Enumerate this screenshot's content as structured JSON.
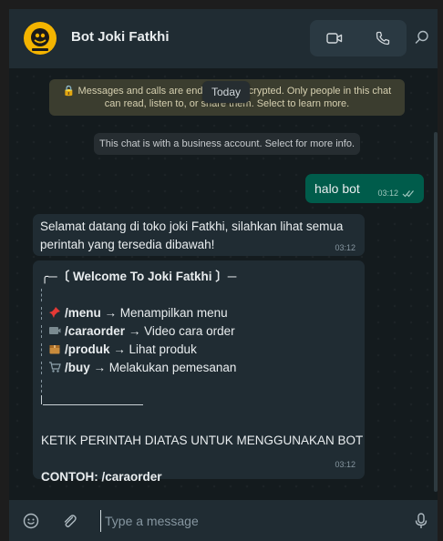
{
  "header": {
    "title": "Bot Joki Fatkhi",
    "icons": {
      "video": "video-camera-icon",
      "call": "phone-icon",
      "search": "search-icon"
    }
  },
  "chat": {
    "encryption_notice": "🔒 Messages and calls are end-to-end encrypted. Only people in this chat can read, listen to, or share them. Select to learn more.",
    "today_label": "Today",
    "business_notice": "This chat is with a business account. Select for more info.",
    "messages": [
      {
        "direction": "out",
        "text": "halo bot",
        "time": "03:12",
        "status": "read"
      },
      {
        "direction": "in",
        "text": "Selamat datang di toko joki Fatkhi, silahkan lihat semua perintah yang tersedia dibawah!",
        "time": "03:12"
      },
      {
        "direction": "in",
        "time": "03:12",
        "header": "╭─〔 Welcome To Joki Fatkhi 〕─",
        "commands": [
          {
            "cmd": "/menu",
            "desc": "→ Menampilkan menu"
          },
          {
            "cmd": "/caraorder",
            "desc": "→ Video cara order"
          },
          {
            "cmd": "/produk",
            "desc": "→ Lihat produk"
          },
          {
            "cmd": "/buy",
            "desc": "→ Melakukan pemesanan"
          }
        ],
        "instruction": "KETIK PERINTAH DIATAS UNTUK MENGGUNAKAN BOT",
        "example": "CONTOH: /caraorder"
      }
    ]
  },
  "footer": {
    "placeholder": "Type a message"
  },
  "colors": {
    "header_bg": "#202c33",
    "chat_bg": "#141b1e",
    "outgoing_bubble": "#005c4b",
    "incoming_bubble": "#202c33",
    "encryption_bg": "#3b3d2f",
    "avatar_bg": "#f4b400"
  }
}
